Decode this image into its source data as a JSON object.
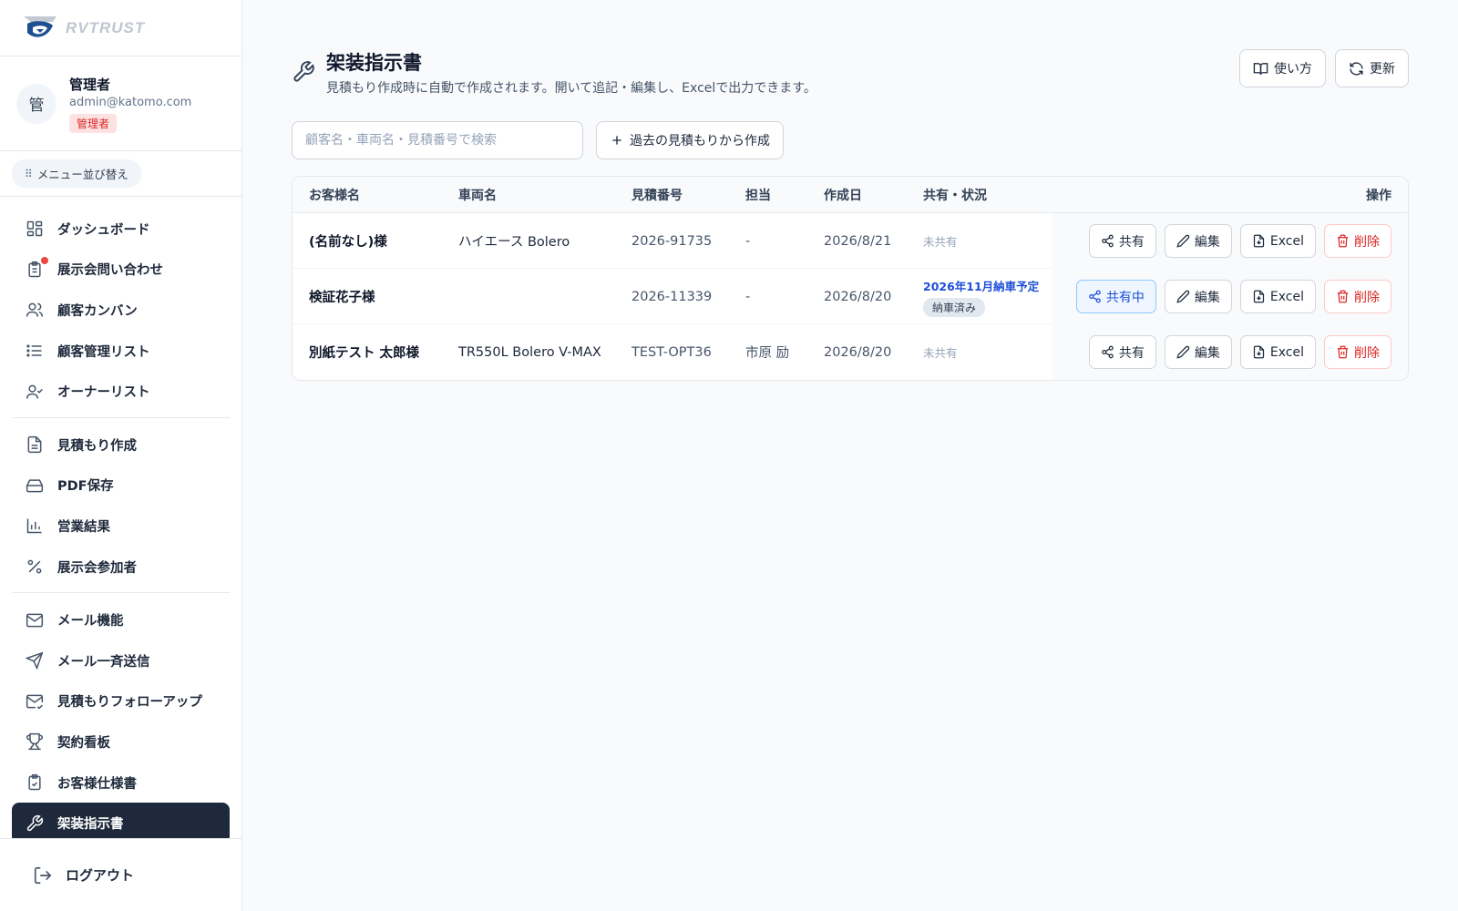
{
  "brand": {
    "name": "RVTRUST"
  },
  "user": {
    "initial": "管",
    "name": "管理者",
    "email": "admin@katomo.com",
    "role": "管理者"
  },
  "sidebar": {
    "reorder_label": "メニュー並び替え",
    "items": [
      {
        "label": "ダッシュボード",
        "icon": "dashboard-icon"
      },
      {
        "label": "展示会問い合わせ",
        "icon": "clipboard-list-icon"
      },
      {
        "label": "顧客カンバン",
        "icon": "users-icon"
      },
      {
        "label": "顧客管理リスト",
        "icon": "list-icon"
      },
      {
        "label": "オーナーリスト",
        "icon": "user-check-icon"
      },
      {
        "label": "見積もり作成",
        "icon": "file-text-icon"
      },
      {
        "label": "PDF保存",
        "icon": "hard-drive-icon"
      },
      {
        "label": "営業結果",
        "icon": "bar-chart-icon"
      },
      {
        "label": "展示会参加者",
        "icon": "percent-icon"
      },
      {
        "label": "メール機能",
        "icon": "mail-icon"
      },
      {
        "label": "メール一斉送信",
        "icon": "send-icon"
      },
      {
        "label": "見積もりフォローアップ",
        "icon": "mail-check-icon"
      },
      {
        "label": "契約看板",
        "icon": "trophy-icon"
      },
      {
        "label": "お客様仕様書",
        "icon": "clipboard-check-icon"
      },
      {
        "label": "架装指示書",
        "icon": "wrench-icon"
      }
    ],
    "logout_label": "ログアウト"
  },
  "header": {
    "title": "架装指示書",
    "subtitle": "見積もり作成時に自動で作成されます。開いて追記・編集し、Excelで出力できます。",
    "guide_label": "使い方",
    "refresh_label": "更新"
  },
  "search": {
    "placeholder": "顧客名・車両名・見積番号で検索",
    "value": "",
    "create_label": "過去の見積もりから作成"
  },
  "table": {
    "headers": {
      "customer": "お客様名",
      "vehicle": "車両名",
      "quote_no": "見積番号",
      "staff": "担当",
      "created": "作成日",
      "status": "共有・状況",
      "actions": "操作"
    },
    "rows": [
      {
        "customer": "(名前なし)様",
        "vehicle": "ハイエース Bolero",
        "quote_no": "2026-91735",
        "staff": "-",
        "created": "2026/8/21",
        "status": "未共有",
        "delivery": "",
        "badge": "",
        "share_label": "共有"
      },
      {
        "customer": "検証花子様",
        "vehicle": "",
        "quote_no": "2026-11339",
        "staff": "-",
        "created": "2026/8/20",
        "status": "",
        "delivery": "2026年11月納車予定",
        "badge": "納車済み",
        "share_label": "共有中"
      },
      {
        "customer": "別紙テスト 太郎様",
        "vehicle": "TR550L Bolero V-MAX",
        "quote_no": "TEST-OPT36",
        "staff": "市原 励",
        "created": "2026/8/20",
        "status": "未共有",
        "delivery": "",
        "badge": "",
        "share_label": "共有"
      }
    ],
    "actions": {
      "edit": "編集",
      "excel": "Excel",
      "delete": "削除"
    }
  },
  "colors": {
    "accent": "#1e293b",
    "danger": "#dc2626",
    "link": "#1d4ed8",
    "notification": "#ef4444"
  }
}
